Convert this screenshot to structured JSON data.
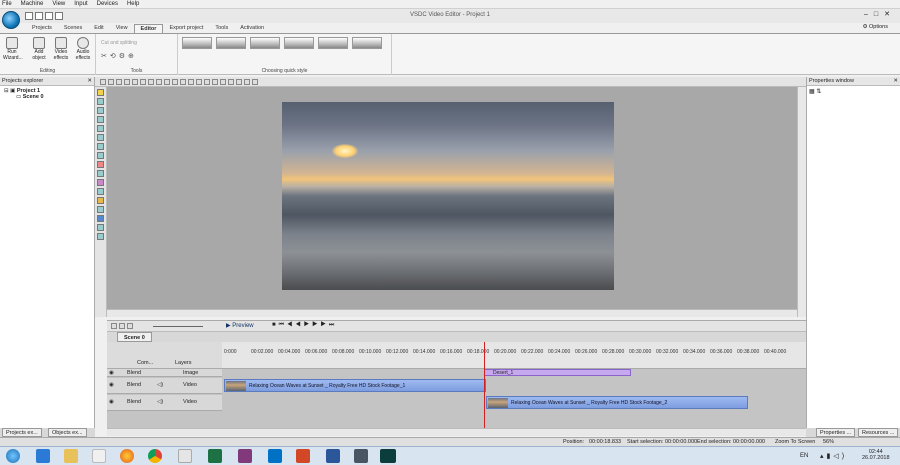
{
  "menubar": {
    "items": [
      "File",
      "Machine",
      "View",
      "Input",
      "Devices",
      "Help"
    ]
  },
  "window": {
    "title": "VSDC Video Editor - Project 1"
  },
  "tabs": [
    "Projects",
    "Scenes",
    "Edit",
    "View",
    "Editor",
    "Export project",
    "Tools",
    "Activation"
  ],
  "active_tab": "Editor",
  "options_label": "Options",
  "ribbon": {
    "editing_label": "Editing",
    "run_wizard": "Run Wizard...",
    "add_object": "Add object",
    "video_effects": "Video effects",
    "audio_effects": "Audio effects",
    "tools_label": "Tools",
    "cut_and_splitting": "Cut and splitting",
    "quick_style_label": "Choosing quick style"
  },
  "projects_explorer": {
    "title": "Projects explorer",
    "project": "Project 1",
    "scene": "Scene 0"
  },
  "properties_window": {
    "title": "Properties window"
  },
  "timeline": {
    "preview_label": "Preview",
    "scene_tab": "Scene 0",
    "col_com": "Com...",
    "col_layers": "Layers",
    "ticks": [
      "0:000",
      "00:02.000",
      "00:04.000",
      "00:06.000",
      "00:08.000",
      "00:10.000",
      "00:12.000",
      "00:14.000",
      "00:16.000",
      "00:18.000",
      "00:20.000",
      "00:22.000",
      "00:24.000",
      "00:26.000",
      "00:28.000",
      "00:30.000",
      "00:32.000",
      "00:34.000",
      "00:36.000",
      "00:38.000",
      "00:40.000"
    ],
    "tracks": [
      {
        "blend": "Blend",
        "type": "Image"
      },
      {
        "blend": "Blend",
        "type": "Video"
      },
      {
        "blend": "Blend",
        "type": "Video"
      }
    ],
    "clips": {
      "desert": "Desert_1",
      "clip1": "Relaxing Ocean Waves at Sunset _ Royalty Free HD Stock Footage_1",
      "clip2": "Relaxing Ocean Waves at Sunset _ Royalty Free HD Stock Footage_2"
    }
  },
  "bottom_tabs": {
    "projects": "Projects ex...",
    "objects": "Objects ex...",
    "properties": "Properties ...",
    "resources": "Resources ..."
  },
  "status": {
    "position_label": "Position:",
    "position": "00:00:18.833",
    "start_label": "Start selection:",
    "start": "00:00:00.000",
    "end_label": "End selection:",
    "end": "00:00:00.000",
    "zoom_label": "Zoom To Screen",
    "zoom": "56%"
  },
  "taskbar": {
    "lang": "EN",
    "time": "02:44",
    "date": "26.07.2018"
  }
}
